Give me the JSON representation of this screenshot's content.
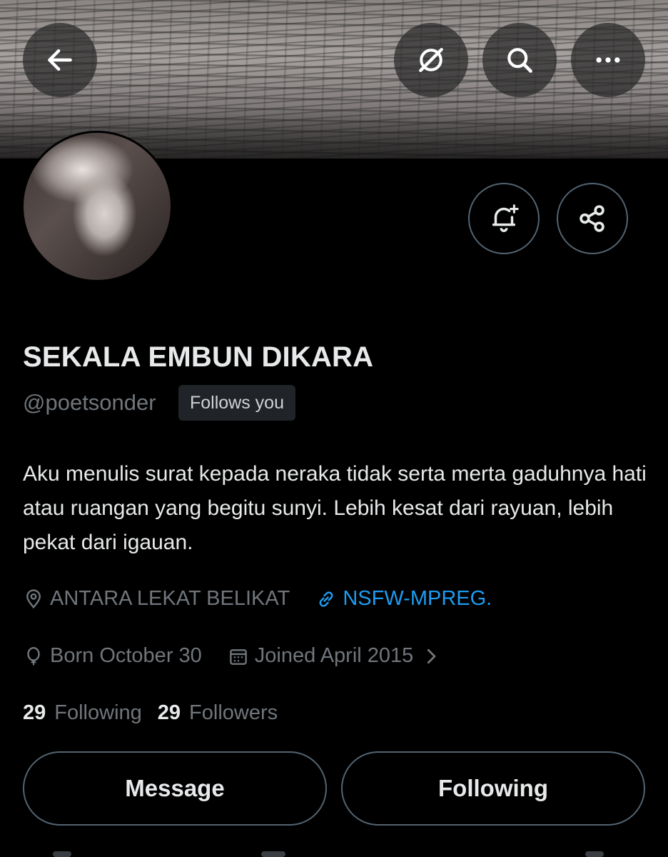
{
  "header": {
    "back_icon": "arrow-left-icon",
    "grok_icon": "grok-slash-icon",
    "search_icon": "search-icon",
    "more_icon": "more-dots-icon"
  },
  "profile": {
    "display_name": "SEKALA EMBUN DIKARA",
    "handle": "@poetsonder",
    "follows_you": "Follows you",
    "bio": "Aku menulis surat kepada neraka tidak serta merta gaduhnya hati atau ruangan yang begitu sunyi. Lebih kesat dari rayuan, lebih pekat dari igauan.",
    "location": "ANTARA LEKAT BELIKAT",
    "link": "NSFW-MPREG.",
    "birthday": "Born October 30",
    "joined": "Joined April 2015",
    "following_count": "29",
    "following_label": "Following",
    "followers_count": "29",
    "followers_label": "Followers"
  },
  "actions": {
    "message_label": "Message",
    "following_label": "Following"
  },
  "colors": {
    "background": "#000000",
    "text_primary": "#e7e9ea",
    "text_secondary": "#71767b",
    "link": "#1d9bf0",
    "border": "#536471"
  }
}
